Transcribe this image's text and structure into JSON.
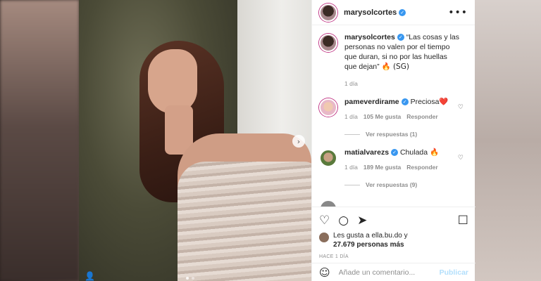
{
  "post": {
    "author": "marysolcortes",
    "more_icon": "•••",
    "next_icon": "›",
    "tag_icon": "👤"
  },
  "caption": {
    "author": "marysolcortes",
    "text": "“Las cosas y las personas no valen por el tiempo que duran, si no por las huellas que dejan”",
    "suffix": "🔥 (SG)",
    "time": "1 día"
  },
  "comments": [
    {
      "author": "pameverdirame",
      "text": "Preciosa",
      "emoji": "❤️",
      "time": "1 día",
      "likes": "105 Me gusta",
      "reply": "Responder",
      "view_replies": "Ver respuestas (1)"
    },
    {
      "author": "matialvarezs",
      "text": "Chulada",
      "emoji": "🔥",
      "time": "1 día",
      "likes": "189 Me gusta",
      "reply": "Responder",
      "view_replies": "Ver respuestas (9)"
    }
  ],
  "actions": {
    "like_icon": "♡",
    "comment_icon": "○",
    "share_icon": "➤",
    "save_icon": "☐"
  },
  "likes": {
    "line1": "Les gusta a ella.bu.do y",
    "line2": "27.679 personas más"
  },
  "time_ago": "HACE 1 DÍA",
  "add_comment": {
    "placeholder": "Añade un comentario...",
    "publish": "Publicar",
    "emoji_icon": "☺"
  },
  "colors": {
    "link": "#3897f0",
    "publish_disabled": "#b2dffc"
  }
}
